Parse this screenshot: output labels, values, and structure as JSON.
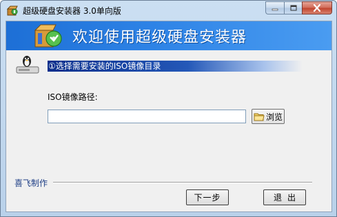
{
  "window": {
    "title": "超级硬盘安装器 3.0单向版"
  },
  "banner": {
    "title": "欢迎使用超级硬盘安装器"
  },
  "step": {
    "text": "①选择需要安装的ISO镜像目录"
  },
  "form": {
    "path_label": "ISO镜像路径:",
    "path_value": "",
    "browse_label": "浏览"
  },
  "footer": {
    "credit": "喜飞制作",
    "next_label": "下一步",
    "exit_label": "退出"
  },
  "icons": {
    "app": "installer-box-icon",
    "banner": "disc-box-icon",
    "step": "linux-drive-icon",
    "browse": "folder-icon"
  },
  "colors": {
    "banner": "#2e83e6",
    "step_bar": "#0a2e8c",
    "close_button": "#c0432e",
    "credit_text": "#1f3f86"
  }
}
